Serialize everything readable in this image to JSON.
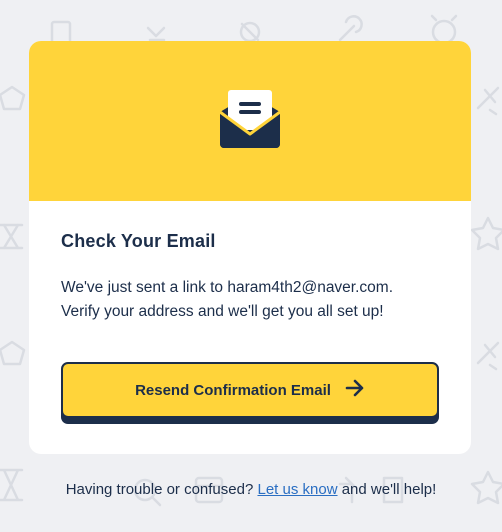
{
  "card": {
    "title": "Check Your Email",
    "message_line1": "We've just sent a link to haram4th2@naver.com.",
    "message_line2": "Verify your address and we'll get you all set up!",
    "button_label": "Resend Confirmation Email",
    "button_icon": "arrow-right-icon",
    "header_icon": "open-envelope-icon"
  },
  "footer": {
    "before": "Having trouble or confused?",
    "link": "Let us know",
    "after": "and we'll help!"
  },
  "colors": {
    "accent": "#ffd43a",
    "navy": "#1c2e4a",
    "link": "#2a6ec2",
    "background": "#eff0f3"
  }
}
